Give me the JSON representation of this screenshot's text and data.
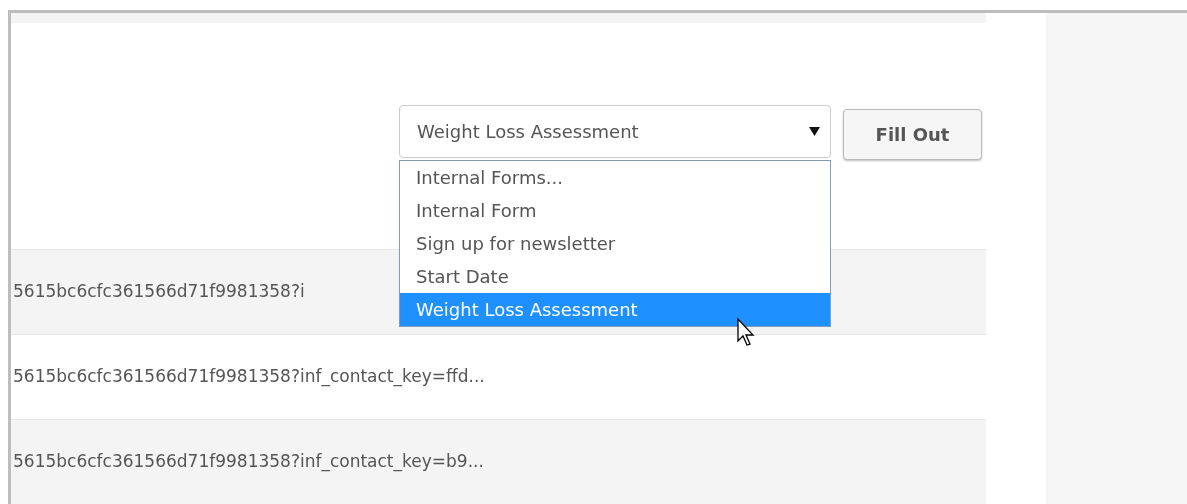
{
  "form_picker": {
    "select": {
      "value": "Weight Loss Assessment",
      "expanded": true
    },
    "options": [
      {
        "label": "Internal Forms...",
        "selected": false
      },
      {
        "label": "Internal Form",
        "selected": false
      },
      {
        "label": "Sign up for newsletter",
        "selected": false
      },
      {
        "label": "Start Date",
        "selected": false
      },
      {
        "label": "Weight Loss Assessment",
        "selected": true
      }
    ],
    "button": "Fill Out"
  },
  "rows": [
    {
      "url": "5615bc6cfc361566d71f9981358?i"
    },
    {
      "url": "5615bc6cfc361566d71f9981358?inf_contact_key=ffd..."
    },
    {
      "url": "5615bc6cfc361566d71f9981358?inf_contact_key=b9..."
    }
  ]
}
